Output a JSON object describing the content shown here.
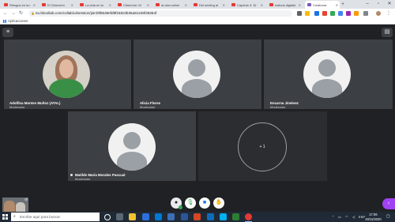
{
  "browser": {
    "tabs": [
      {
        "title": "Riesgos en la r",
        "icon": "youtube-icon"
      },
      {
        "title": "El Cibercrim",
        "icon": "youtube-icon"
      },
      {
        "title": "La vida en la",
        "icon": "youtube-icon"
      },
      {
        "title": "Cibercrim: M",
        "icon": "youtube-icon"
      },
      {
        "title": "la vida online",
        "icon": "youtube-icon"
      },
      {
        "title": "Del sexting al",
        "icon": "youtube-icon"
      },
      {
        "title": "Capítulo 3. Dr",
        "icon": "youtube-icon"
      },
      {
        "title": "nativos digitale",
        "icon": "youtube-icon"
      },
      {
        "title": "Colaborar",
        "icon": "blackboard-icon"
      }
    ],
    "url": "eu.bbcollab.com/collab/ui/session/join/9f6539efd9f348c0b35a91446f49354f",
    "bookmarks_apps": "Aplicaciones"
  },
  "conference": {
    "participants": [
      {
        "name": "Adolfina Montes Muñoz (ATAL)",
        "role": "Moderador",
        "has_photo": true
      },
      {
        "name": "Alicia Flores",
        "role": "Moderador",
        "has_photo": false
      },
      {
        "name": "Encarna Jiménez",
        "role": "Moderador",
        "has_photo": false
      },
      {
        "name": "Matilde María Morales Pascual",
        "role": "Moderador",
        "has_photo": false
      }
    ],
    "more_count": "+ 1",
    "controls": [
      "avatar-status",
      "microphone",
      "camera",
      "raise-hand"
    ]
  },
  "taskbar": {
    "search_placeholder": "Escribe aquí para buscar",
    "time": "17:06",
    "date": "19/11/2020"
  },
  "colors": {
    "stage_bg": "#202124",
    "tile_bg": "#3c3f43",
    "accent": "#a142f4",
    "blue": "#1a73e8"
  }
}
